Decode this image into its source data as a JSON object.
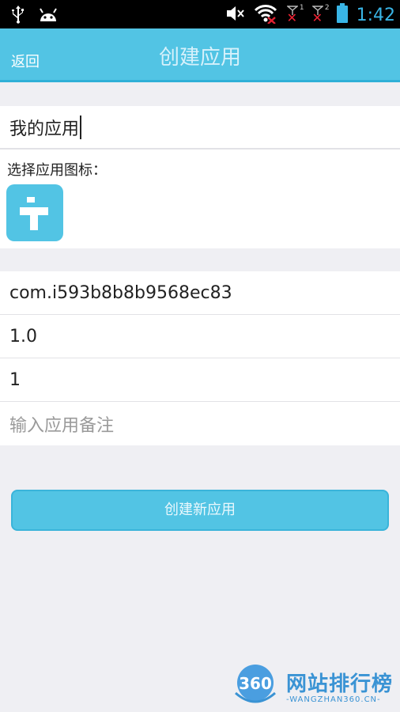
{
  "status_bar": {
    "time": "1:42",
    "sim1_label": "1",
    "sim2_label": "2"
  },
  "header": {
    "back_label": "返回",
    "title": "创建应用"
  },
  "form": {
    "app_name_value": "我的应用",
    "icon_label": "选择应用图标：",
    "package_name_value": "com.i593b8b8b9568ec83",
    "version_name_value": "1.0",
    "version_code_value": "1",
    "remark_placeholder": "输入应用备注"
  },
  "actions": {
    "create_label": "创建新应用"
  },
  "watermark": {
    "logo_text": "360",
    "site_name": "网站排行榜",
    "site_domain": "-WANGZHAN360.CN-"
  },
  "colors": {
    "accent": "#52c4e4",
    "status_time": "#39b5e6",
    "error_x": "#e22233",
    "watermark": "#3a93d4"
  }
}
